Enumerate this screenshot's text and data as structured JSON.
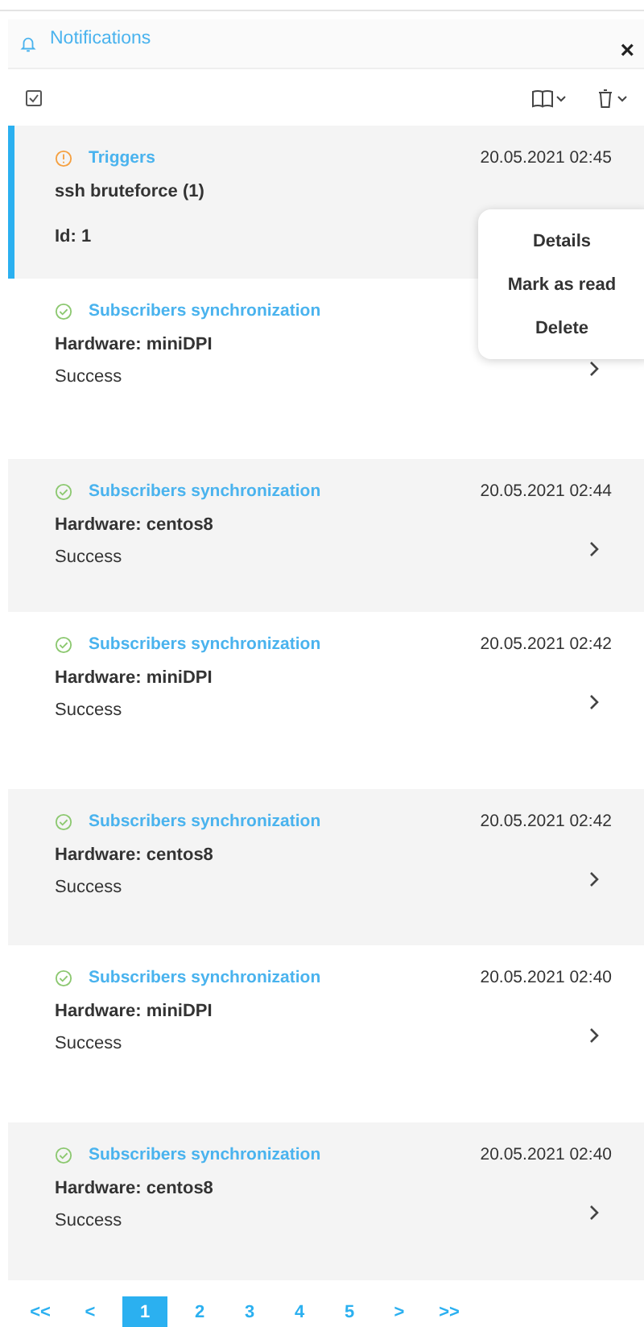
{
  "header": {
    "title": "Notifications",
    "close": "×"
  },
  "notifications": [
    {
      "kind": "warning",
      "title": "Triggers",
      "date": "20.05.2021 02:45",
      "line1": "ssh bruteforce (1)",
      "line2": "Id: 1",
      "selected": true
    },
    {
      "kind": "success",
      "title": "Subscribers synchronization",
      "line1": "Hardware: miniDPI",
      "line2": "Success",
      "selected": false
    },
    {
      "kind": "success",
      "title": "Subscribers synchronization",
      "date": "20.05.2021 02:44",
      "line1": "Hardware: centos8",
      "line2": "Success",
      "selected": false
    },
    {
      "kind": "success",
      "title": "Subscribers synchronization",
      "date": "20.05.2021 02:42",
      "line1": "Hardware: miniDPI",
      "line2": "Success",
      "selected": false
    },
    {
      "kind": "success",
      "title": "Subscribers synchronization",
      "date": "20.05.2021 02:42",
      "line1": "Hardware: centos8",
      "line2": "Success",
      "selected": false
    },
    {
      "kind": "success",
      "title": "Subscribers synchronization",
      "date": "20.05.2021 02:40",
      "line1": "Hardware: miniDPI",
      "line2": "Success",
      "selected": false
    },
    {
      "kind": "success",
      "title": "Subscribers synchronization",
      "date": "20.05.2021 02:40",
      "line1": "Hardware: centos8",
      "line2": "Success",
      "selected": false
    }
  ],
  "context_menu": [
    "Details",
    "Mark as read",
    "Delete"
  ],
  "pagination": [
    {
      "label": "<<",
      "selected": false
    },
    {
      "label": "<",
      "selected": false
    },
    {
      "label": "1",
      "selected": true
    },
    {
      "label": "2",
      "selected": false
    },
    {
      "label": "3",
      "selected": false
    },
    {
      "label": "4",
      "selected": false
    },
    {
      "label": "5",
      "selected": false
    },
    {
      "label": ">",
      "selected": false
    },
    {
      "label": ">>",
      "selected": false
    }
  ]
}
